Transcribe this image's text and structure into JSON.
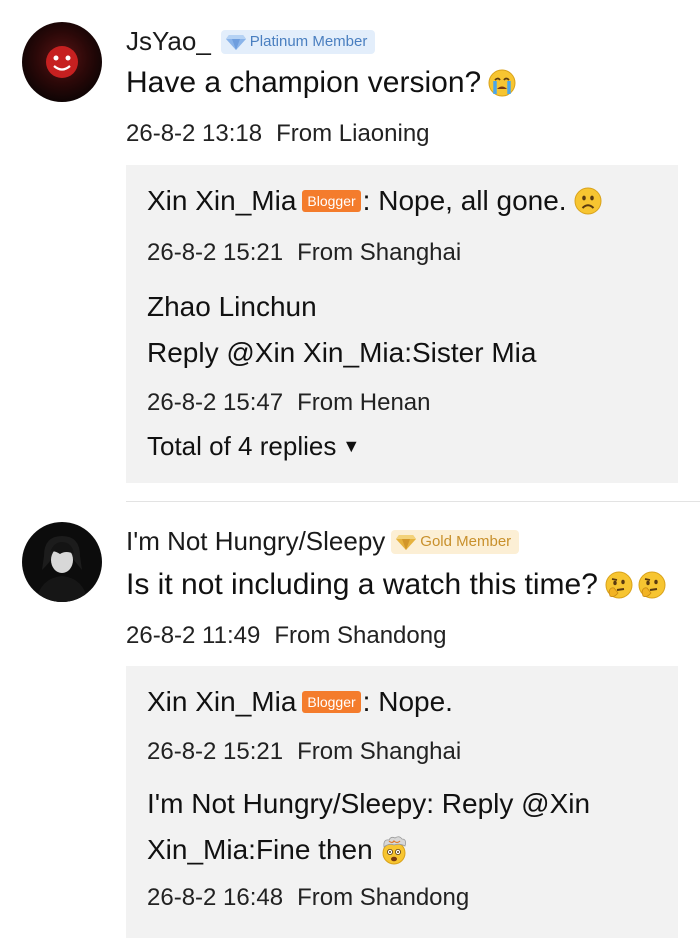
{
  "comments": [
    {
      "username": "JsYao_",
      "member_badge": "Platinum Member",
      "text": "Have a champion version?",
      "emoji": "crying-face",
      "time": "26-8-2 13:18",
      "location": "From Liaoning",
      "replies": [
        {
          "author": "Xin Xin_Mia",
          "author_badge": "Blogger",
          "text": ": Nope, all gone.",
          "emoji": "frowning-face",
          "time": "26-8-2 15:21",
          "location": "From Shanghai"
        },
        {
          "author": "Zhao Linchun",
          "text": "Reply @Xin Xin_Mia:Sister Mia",
          "time": "26-8-2 15:47",
          "location": "From Henan"
        }
      ],
      "more_replies": "Total of 4 replies"
    },
    {
      "username": "I'm Not Hungry/Sleepy",
      "member_badge": "Gold Member",
      "text": "Is it not including a watch this time?",
      "emoji": "thinking-face x2",
      "time": "26-8-2 11:49",
      "location": "From Shandong",
      "replies": [
        {
          "author": "Xin Xin_Mia",
          "author_badge": "Blogger",
          "text": ": Nope.",
          "time": "26-8-2 15:21",
          "location": "From Shanghai"
        },
        {
          "text_line1": "I'm Not Hungry/Sleepy: Reply @Xin",
          "text_line2": "Xin_Mia:Fine then",
          "emoji": "exploding-head",
          "time": "26-8-2 16:48",
          "location": "From Shandong"
        }
      ]
    }
  ],
  "colors": {
    "blogger_badge": "#f47c2c",
    "platinum_badge_bg": "#e3eefb",
    "gold_badge_bg": "#fcefd5",
    "reply_box_bg": "#f2f2f2"
  }
}
